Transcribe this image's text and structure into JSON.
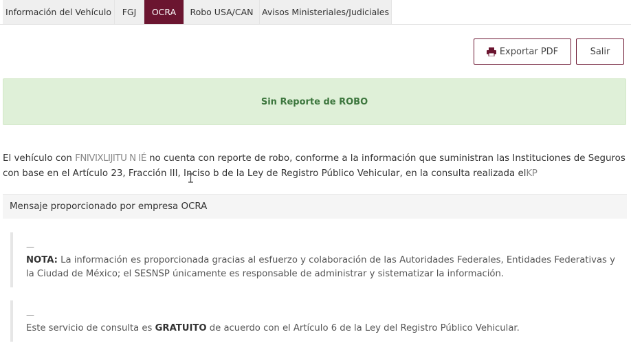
{
  "tabs": [
    {
      "label": "Información del Vehículo"
    },
    {
      "label": "FGJ"
    },
    {
      "label": "OCRA"
    },
    {
      "label": "Robo USA/CAN"
    },
    {
      "label": "Avisos Ministeriales/Judiciales"
    }
  ],
  "active_tab": "OCRA",
  "toolbar": {
    "export_label": "Exportar PDF",
    "exit_label": "Salir"
  },
  "alert": {
    "text": "Sin Reporte de ROBO"
  },
  "report": {
    "p1": "El vehículo con ",
    "redacted_plate": "FNIVIXLIJITU N IÉ",
    "p2": " no cuenta con reporte de robo, conforme a la información que suministran las Instituciones de Seguros con base en el Artículo 23, Fracción III, Inciso b de la Ley de Registro Público Vehicular, en la consulta realizada el",
    "redacted_date": "KP"
  },
  "message_bar": {
    "text": "Mensaje proporcionado por empresa OCRA"
  },
  "notes": [
    {
      "dash": "—",
      "lead": "NOTA:",
      "text": " La información es proporcionada gracias al esfuerzo y colaboración de las Autoridades Federales, Entidades Federativas y la Ciudad de México; el SESNSP únicamente es responsable de administrar y sistematizar la información."
    },
    {
      "dash": "—",
      "pre": "Este servicio de consulta es ",
      "bold": "GRATUITO",
      "post": " de acuerdo con el Artículo 6 de la Ley del Registro Público Vehicular."
    }
  ],
  "colors": {
    "accent": "#6b1530",
    "alert_bg": "#dff0d8",
    "alert_text": "#3c763d"
  }
}
